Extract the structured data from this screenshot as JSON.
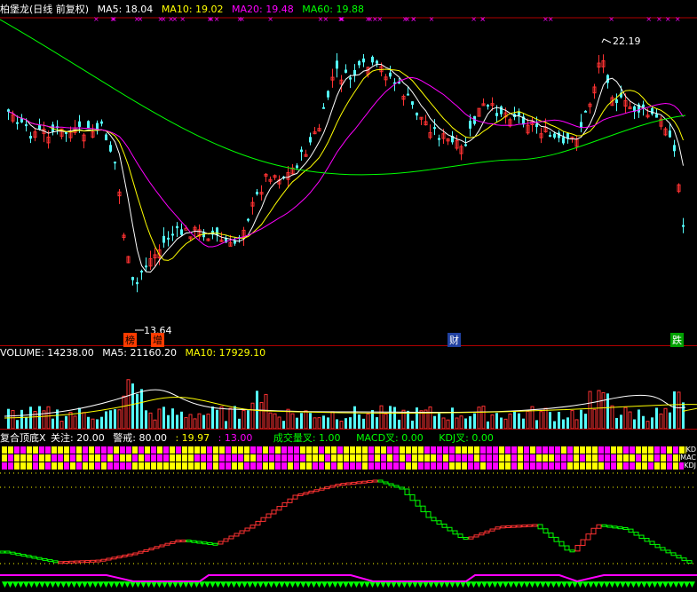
{
  "main": {
    "title": "柏堡龙(日线 前复权)",
    "ma5_label": "MA5: 18.04",
    "ma10_label": "MA10: 19.02",
    "ma20_label": "MA20: 19.48",
    "ma60_label": "MA60: 19.88",
    "high_label": "22.19",
    "low_label": "13.64",
    "markers": [
      "榜",
      "增",
      "财",
      "跌"
    ]
  },
  "volume": {
    "volume_label": "VOLUME: 14238.00",
    "ma5_label": "MA5: 21160.20",
    "ma10_label": "MA10: 17929.10"
  },
  "indicator": {
    "title": "复合顶底X",
    "attention_label": "关注: 20.00",
    "warning_label": "警戒: 80.00",
    "value1": ": 19.97",
    "value2": ": 13.00",
    "vol_cross_label": "成交量叉: 1.00",
    "macd_cross_label": "MACD叉: 0.00",
    "kdj_cross_label": "KDJ叉: 0.00",
    "strip_labels": [
      "KD",
      "MAC",
      "KDJ"
    ]
  },
  "colors": {
    "up": "#ff3232",
    "down": "#54fcfc",
    "ma5": "#ffffff",
    "ma10": "#ffff00",
    "ma20": "#ff00ff",
    "ma60": "#00ff00",
    "grid_red": "#b00000"
  }
}
